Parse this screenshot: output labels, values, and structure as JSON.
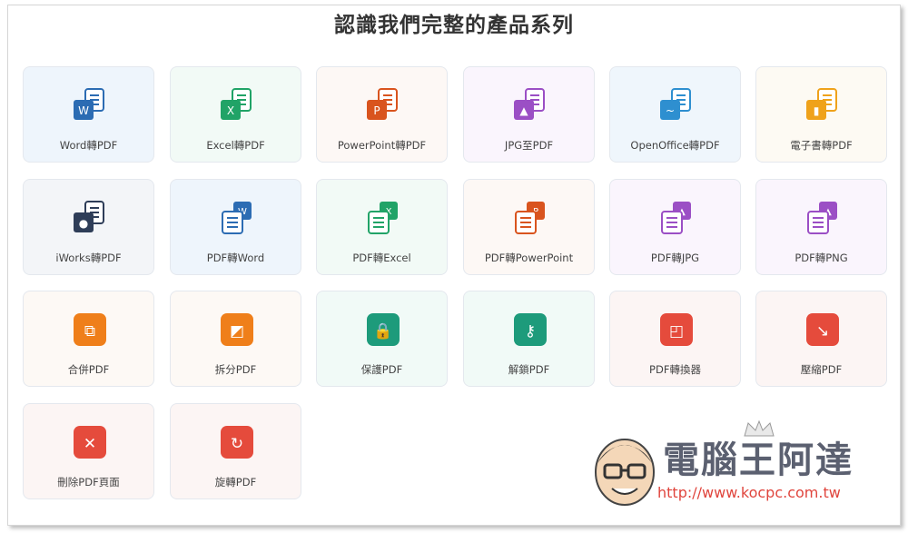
{
  "title": "認識我們完整的產品系列",
  "cards": [
    {
      "label": "Word轉PDF",
      "icon": "word-to-pdf-icon",
      "color": "#2c6cb3",
      "bg": "#eef5fc",
      "glyph": "W",
      "kind": "doc"
    },
    {
      "label": "Excel轉PDF",
      "icon": "excel-to-pdf-icon",
      "color": "#21a367",
      "bg": "#f2faf6",
      "glyph": "X",
      "kind": "doc"
    },
    {
      "label": "PowerPoint轉PDF",
      "icon": "powerpoint-to-pdf-icon",
      "color": "#d9541e",
      "bg": "#fdf8f5",
      "glyph": "P",
      "kind": "doc"
    },
    {
      "label": "JPG至PDF",
      "icon": "jpg-to-pdf-icon",
      "color": "#9b4fc5",
      "bg": "#faf5fd",
      "glyph": "▲",
      "kind": "doc"
    },
    {
      "label": "OpenOffice轉PDF",
      "icon": "openoffice-to-pdf-icon",
      "color": "#2e8fd0",
      "bg": "#eff6fc",
      "glyph": "~",
      "kind": "doc"
    },
    {
      "label": "電子書轉PDF",
      "icon": "ebook-to-pdf-icon",
      "color": "#efa21b",
      "bg": "#fdfaf3",
      "glyph": "▮",
      "kind": "doc"
    },
    {
      "label": "iWorks轉PDF",
      "icon": "iworks-to-pdf-icon",
      "color": "#2e3d58",
      "bg": "#f3f5f8",
      "glyph": "●",
      "kind": "doc"
    },
    {
      "label": "PDF轉Word",
      "icon": "pdf-to-word-icon",
      "color": "#2c6cb3",
      "bg": "#eef5fc",
      "glyph": "W",
      "kind": "rev"
    },
    {
      "label": "PDF轉Excel",
      "icon": "pdf-to-excel-icon",
      "color": "#21a367",
      "bg": "#f2faf6",
      "glyph": "X",
      "kind": "rev"
    },
    {
      "label": "PDF轉PowerPoint",
      "icon": "pdf-to-powerpoint-icon",
      "color": "#d9541e",
      "bg": "#fdf8f5",
      "glyph": "P",
      "kind": "rev"
    },
    {
      "label": "PDF轉JPG",
      "icon": "pdf-to-jpg-icon",
      "color": "#9b4fc5",
      "bg": "#faf5fd",
      "glyph": "▲",
      "kind": "rev"
    },
    {
      "label": "PDF轉PNG",
      "icon": "pdf-to-png-icon",
      "color": "#9b4fc5",
      "bg": "#faf5fd",
      "glyph": "▲",
      "kind": "rev"
    },
    {
      "label": "合併PDF",
      "icon": "merge-pdf-icon",
      "color": "#ef7f1a",
      "bg": "#fdf9f5",
      "glyph": "⧉",
      "kind": "solid"
    },
    {
      "label": "拆分PDF",
      "icon": "split-pdf-icon",
      "color": "#ef7f1a",
      "bg": "#fdf9f5",
      "glyph": "◩",
      "kind": "solid"
    },
    {
      "label": "保護PDF",
      "icon": "protect-pdf-icon",
      "color": "#1d9b7b",
      "bg": "#f1faf7",
      "glyph": "🔒",
      "kind": "solid"
    },
    {
      "label": "解鎖PDF",
      "icon": "unlock-pdf-icon",
      "color": "#1d9b7b",
      "bg": "#f1faf7",
      "glyph": "⚷",
      "kind": "solid"
    },
    {
      "label": "PDF轉換器",
      "icon": "pdf-converter-icon",
      "color": "#e54b3c",
      "bg": "#fcf5f4",
      "glyph": "◰",
      "kind": "solid"
    },
    {
      "label": "壓縮PDF",
      "icon": "compress-pdf-icon",
      "color": "#e54b3c",
      "bg": "#fcf5f4",
      "glyph": "↘",
      "kind": "solid"
    },
    {
      "label": "刪除PDF頁面",
      "icon": "delete-pdf-pages-icon",
      "color": "#e54b3c",
      "bg": "#fcf5f4",
      "glyph": "✕",
      "kind": "solid"
    },
    {
      "label": "旋轉PDF",
      "icon": "rotate-pdf-icon",
      "color": "#e54b3c",
      "bg": "#fcf5f4",
      "glyph": "↻",
      "kind": "solid"
    }
  ],
  "watermark": {
    "name": "電腦王阿達",
    "url": "http://www.kocpc.com.tw"
  }
}
